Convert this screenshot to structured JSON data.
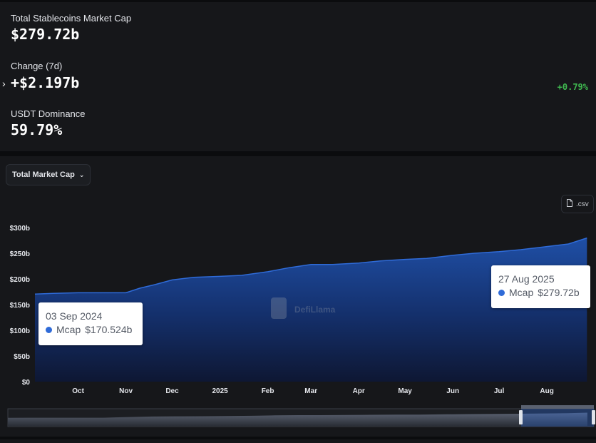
{
  "stats": {
    "market_cap_label": "Total Stablecoins Market Cap",
    "market_cap_value": "$279.72b",
    "change_label": "Change (7d)",
    "change_value": "+$2.197b",
    "change_percent": "+0.79%",
    "dominance_label": "USDT Dominance",
    "dominance_value": "59.79%"
  },
  "controls": {
    "metric_select": "Total Market Cap",
    "csv_button": ".csv"
  },
  "watermark": "DefiLlama",
  "colors": {
    "series": "#2f6bd8",
    "positive": "#3fb950",
    "panel": "#16171a"
  },
  "tooltips": [
    {
      "date": "03 Sep 2024",
      "series": "Mcap",
      "value": "$170.524b"
    },
    {
      "date": "27 Aug 2025",
      "series": "Mcap",
      "value": "$279.72b"
    }
  ],
  "chart_data": {
    "type": "area",
    "series": [
      {
        "name": "Mcap",
        "x": [
          "2024-09-03",
          "2024-09-15",
          "2024-10-01",
          "2024-10-15",
          "2024-11-01",
          "2024-11-10",
          "2024-11-20",
          "2024-12-01",
          "2024-12-15",
          "2025-01-01",
          "2025-01-15",
          "2025-02-01",
          "2025-02-15",
          "2025-03-01",
          "2025-03-15",
          "2025-04-01",
          "2025-04-15",
          "2025-05-01",
          "2025-05-15",
          "2025-06-01",
          "2025-06-15",
          "2025-07-01",
          "2025-07-15",
          "2025-08-01",
          "2025-08-15",
          "2025-08-27"
        ],
        "values": [
          170.5,
          172,
          173,
          173,
          173,
          182,
          189,
          198,
          203,
          205,
          207,
          214,
          222,
          228,
          228,
          231,
          235,
          238,
          240,
          246,
          250,
          253,
          257,
          263,
          268,
          279.72
        ]
      }
    ],
    "x_ticks": [
      "Oct",
      "Nov",
      "Dec",
      "2025",
      "Feb",
      "Mar",
      "Apr",
      "May",
      "Jun",
      "Jul",
      "Aug"
    ],
    "y_ticks": [
      "$0",
      "$50b",
      "$100b",
      "$150b",
      "$200b",
      "$250b",
      "$300b"
    ],
    "ylim": [
      0,
      300
    ],
    "grid": false,
    "legend": "none"
  }
}
